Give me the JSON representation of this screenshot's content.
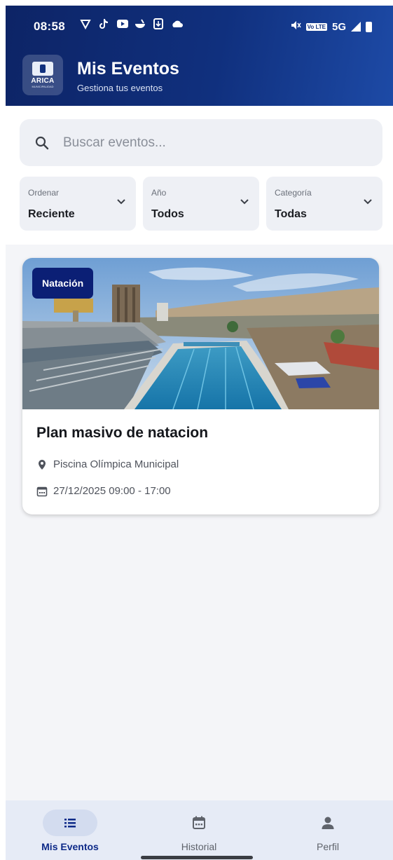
{
  "status_bar": {
    "time": "08:58",
    "network": "5G",
    "lte_badge": "Vo LTE",
    "left_icons": [
      "vpn-icon",
      "tiktok-icon",
      "youtube-icon",
      "food-icon",
      "download-icon",
      "cloud-icon"
    ],
    "right_icons": [
      "mute-icon",
      "lte-icon",
      "signal-icon",
      "battery-icon"
    ]
  },
  "header": {
    "logo_text": "ARICA",
    "logo_subtext": "MUNICIPALIDAD",
    "title": "Mis Eventos",
    "subtitle": "Gestiona tus eventos",
    "gradient_start": "#0d2466",
    "gradient_end": "#1d4aa6"
  },
  "search": {
    "placeholder": "Buscar eventos...",
    "value": ""
  },
  "filters": [
    {
      "label": "Ordenar",
      "value": "Reciente"
    },
    {
      "label": "Año",
      "value": "Todos"
    },
    {
      "label": "Categoría",
      "value": "Todas"
    }
  ],
  "events": [
    {
      "category": "Natación",
      "title": "Plan masivo de natacion",
      "location": "Piscina Olímpica Municipal",
      "datetime": "27/12/2025 09:00 - 17:00",
      "badge_color": "#0b1f75"
    }
  ],
  "bottom_nav": {
    "items": [
      {
        "label": "Mis Eventos",
        "icon": "list-icon",
        "active": true
      },
      {
        "label": "Historial",
        "icon": "calendar-icon",
        "active": false
      },
      {
        "label": "Perfil",
        "icon": "person-icon",
        "active": false
      }
    ],
    "active_color": "#0d2a88"
  }
}
